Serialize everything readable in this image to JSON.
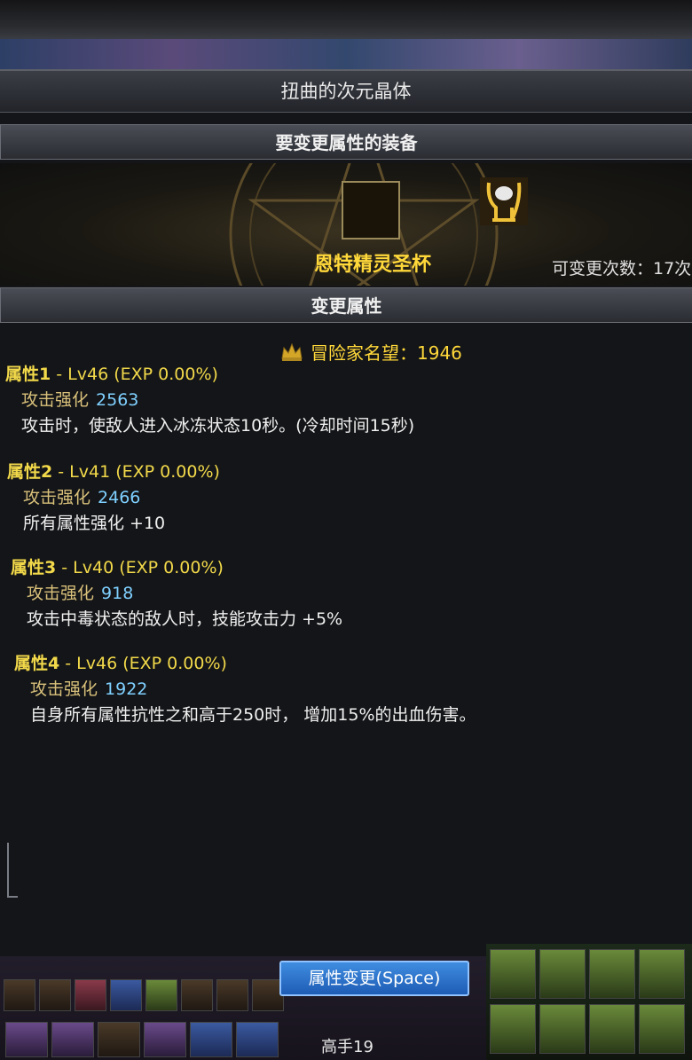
{
  "window": {
    "title": "扭曲的次元晶体"
  },
  "equipment_section": {
    "header": "要变更属性的装备",
    "item_name": "恩特精灵圣杯",
    "change_count": "可变更次数：17次"
  },
  "attributes_section": {
    "header": "变更属性",
    "fame_label": "冒险家名望：1946"
  },
  "attributes": [
    {
      "title": "属性1",
      "level": " - Lv46 (EXP 0.00%)",
      "stat_label": "攻击强化",
      "stat_value": "2563",
      "description": "攻击时，使敌人进入冰冻状态10秒。(冷却时间15秒)"
    },
    {
      "title": "属性2",
      "level": " - Lv41 (EXP 0.00%)",
      "stat_label": "攻击强化",
      "stat_value": "2466",
      "description": "所有属性强化 +10"
    },
    {
      "title": "属性3",
      "level": " - Lv40 (EXP 0.00%)",
      "stat_label": "攻击强化",
      "stat_value": "918",
      "description": "攻击中毒状态的敌人时，技能攻击力 +5%"
    },
    {
      "title": "属性4",
      "level": " - Lv46 (EXP 0.00%)",
      "stat_label": "攻击强化",
      "stat_value": "1922",
      "description": "自身所有属性抗性之和高于250时， 增加15%的出血伤害。"
    }
  ],
  "footer": {
    "change_button": "属性变更(Space)",
    "player_label": "高手19"
  },
  "colors": {
    "attr_title": "#f2d94a",
    "stat_value": "#7fd0ff",
    "item_name": "#ffd83a",
    "button": "#2a6fcf"
  },
  "icons": [
    "chalice-item-icon",
    "fame-crown-icon"
  ]
}
